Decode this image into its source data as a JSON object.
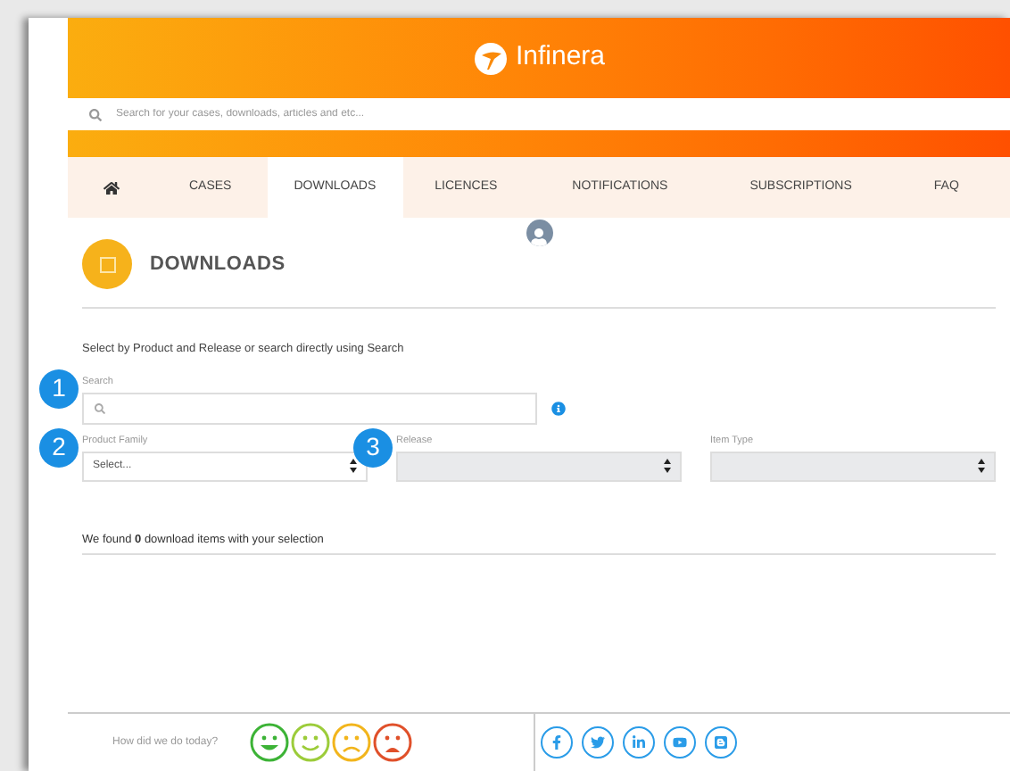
{
  "header": {
    "logo_text": "Infinera"
  },
  "global_search": {
    "placeholder": "Search for your cases, downloads, articles and etc..."
  },
  "nav": {
    "tabs": [
      {
        "label": "CASES",
        "selected": false
      },
      {
        "label": "DOWNLOADS",
        "selected": true
      },
      {
        "label": "LICENCES",
        "selected": false
      },
      {
        "label": "NOTIFICATIONS",
        "selected": false
      },
      {
        "label": "SUBSCRIPTIONS",
        "selected": false
      },
      {
        "label": "FAQ",
        "selected": false
      }
    ]
  },
  "page": {
    "title": "DOWNLOADS",
    "instructions": "Select by Product and Release or search directly using Search",
    "search": {
      "label": "Search",
      "badge": "1"
    },
    "selects": [
      {
        "label": "Product Family",
        "value": "Select...",
        "disabled": false,
        "badge": "2"
      },
      {
        "label": "Release",
        "disabled": true,
        "badge": "3"
      },
      {
        "label": "Item Type",
        "disabled": true
      }
    ],
    "result": "We found **0** download items with your selection"
  },
  "footer": {
    "question": "How did we do today?",
    "ratings": [
      {
        "kind": "laugh",
        "color": "#3cb336"
      },
      {
        "kind": "smile",
        "color": "#9ccc3a"
      },
      {
        "kind": "frown",
        "color": "#f2b51c"
      },
      {
        "kind": "angry",
        "color": "#e0502a"
      }
    ],
    "social": [
      {
        "kind": "facebook"
      },
      {
        "kind": "twitter"
      },
      {
        "kind": "linkedin"
      },
      {
        "kind": "youtube"
      },
      {
        "kind": "blogger"
      }
    ]
  }
}
